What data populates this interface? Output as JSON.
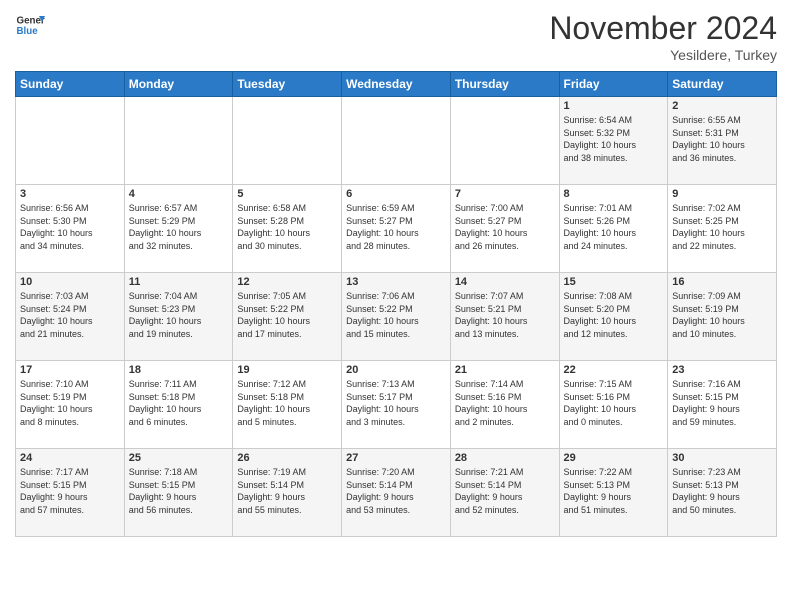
{
  "header": {
    "logo_line1": "General",
    "logo_line2": "Blue",
    "month": "November 2024",
    "location": "Yesildere, Turkey"
  },
  "days_of_week": [
    "Sunday",
    "Monday",
    "Tuesday",
    "Wednesday",
    "Thursday",
    "Friday",
    "Saturday"
  ],
  "weeks": [
    [
      {
        "day": "",
        "info": ""
      },
      {
        "day": "",
        "info": ""
      },
      {
        "day": "",
        "info": ""
      },
      {
        "day": "",
        "info": ""
      },
      {
        "day": "",
        "info": ""
      },
      {
        "day": "1",
        "info": "Sunrise: 6:54 AM\nSunset: 5:32 PM\nDaylight: 10 hours\nand 38 minutes."
      },
      {
        "day": "2",
        "info": "Sunrise: 6:55 AM\nSunset: 5:31 PM\nDaylight: 10 hours\nand 36 minutes."
      }
    ],
    [
      {
        "day": "3",
        "info": "Sunrise: 6:56 AM\nSunset: 5:30 PM\nDaylight: 10 hours\nand 34 minutes."
      },
      {
        "day": "4",
        "info": "Sunrise: 6:57 AM\nSunset: 5:29 PM\nDaylight: 10 hours\nand 32 minutes."
      },
      {
        "day": "5",
        "info": "Sunrise: 6:58 AM\nSunset: 5:28 PM\nDaylight: 10 hours\nand 30 minutes."
      },
      {
        "day": "6",
        "info": "Sunrise: 6:59 AM\nSunset: 5:27 PM\nDaylight: 10 hours\nand 28 minutes."
      },
      {
        "day": "7",
        "info": "Sunrise: 7:00 AM\nSunset: 5:27 PM\nDaylight: 10 hours\nand 26 minutes."
      },
      {
        "day": "8",
        "info": "Sunrise: 7:01 AM\nSunset: 5:26 PM\nDaylight: 10 hours\nand 24 minutes."
      },
      {
        "day": "9",
        "info": "Sunrise: 7:02 AM\nSunset: 5:25 PM\nDaylight: 10 hours\nand 22 minutes."
      }
    ],
    [
      {
        "day": "10",
        "info": "Sunrise: 7:03 AM\nSunset: 5:24 PM\nDaylight: 10 hours\nand 21 minutes."
      },
      {
        "day": "11",
        "info": "Sunrise: 7:04 AM\nSunset: 5:23 PM\nDaylight: 10 hours\nand 19 minutes."
      },
      {
        "day": "12",
        "info": "Sunrise: 7:05 AM\nSunset: 5:22 PM\nDaylight: 10 hours\nand 17 minutes."
      },
      {
        "day": "13",
        "info": "Sunrise: 7:06 AM\nSunset: 5:22 PM\nDaylight: 10 hours\nand 15 minutes."
      },
      {
        "day": "14",
        "info": "Sunrise: 7:07 AM\nSunset: 5:21 PM\nDaylight: 10 hours\nand 13 minutes."
      },
      {
        "day": "15",
        "info": "Sunrise: 7:08 AM\nSunset: 5:20 PM\nDaylight: 10 hours\nand 12 minutes."
      },
      {
        "day": "16",
        "info": "Sunrise: 7:09 AM\nSunset: 5:19 PM\nDaylight: 10 hours\nand 10 minutes."
      }
    ],
    [
      {
        "day": "17",
        "info": "Sunrise: 7:10 AM\nSunset: 5:19 PM\nDaylight: 10 hours\nand 8 minutes."
      },
      {
        "day": "18",
        "info": "Sunrise: 7:11 AM\nSunset: 5:18 PM\nDaylight: 10 hours\nand 6 minutes."
      },
      {
        "day": "19",
        "info": "Sunrise: 7:12 AM\nSunset: 5:18 PM\nDaylight: 10 hours\nand 5 minutes."
      },
      {
        "day": "20",
        "info": "Sunrise: 7:13 AM\nSunset: 5:17 PM\nDaylight: 10 hours\nand 3 minutes."
      },
      {
        "day": "21",
        "info": "Sunrise: 7:14 AM\nSunset: 5:16 PM\nDaylight: 10 hours\nand 2 minutes."
      },
      {
        "day": "22",
        "info": "Sunrise: 7:15 AM\nSunset: 5:16 PM\nDaylight: 10 hours\nand 0 minutes."
      },
      {
        "day": "23",
        "info": "Sunrise: 7:16 AM\nSunset: 5:15 PM\nDaylight: 9 hours\nand 59 minutes."
      }
    ],
    [
      {
        "day": "24",
        "info": "Sunrise: 7:17 AM\nSunset: 5:15 PM\nDaylight: 9 hours\nand 57 minutes."
      },
      {
        "day": "25",
        "info": "Sunrise: 7:18 AM\nSunset: 5:15 PM\nDaylight: 9 hours\nand 56 minutes."
      },
      {
        "day": "26",
        "info": "Sunrise: 7:19 AM\nSunset: 5:14 PM\nDaylight: 9 hours\nand 55 minutes."
      },
      {
        "day": "27",
        "info": "Sunrise: 7:20 AM\nSunset: 5:14 PM\nDaylight: 9 hours\nand 53 minutes."
      },
      {
        "day": "28",
        "info": "Sunrise: 7:21 AM\nSunset: 5:14 PM\nDaylight: 9 hours\nand 52 minutes."
      },
      {
        "day": "29",
        "info": "Sunrise: 7:22 AM\nSunset: 5:13 PM\nDaylight: 9 hours\nand 51 minutes."
      },
      {
        "day": "30",
        "info": "Sunrise: 7:23 AM\nSunset: 5:13 PM\nDaylight: 9 hours\nand 50 minutes."
      }
    ]
  ]
}
